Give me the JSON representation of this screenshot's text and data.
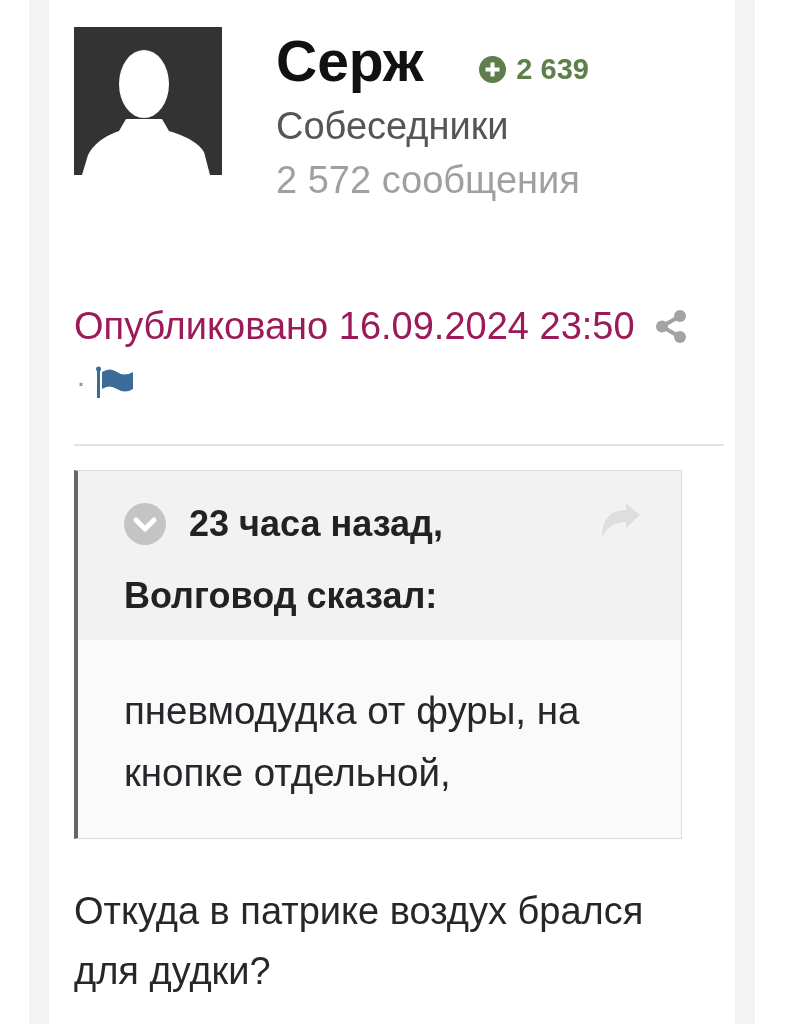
{
  "author": {
    "name": "Серж",
    "reputation": "2 639",
    "group": "Собеседники",
    "post_count": "2 572 сообщения"
  },
  "post_meta": {
    "published": "Опубликовано 16.09.2024 23:50",
    "separator": "·"
  },
  "quote": {
    "time": "23 часа назад,",
    "attribution": "Волговод сказал:",
    "text": "пневмодудка от фуры, на кнопке отдельной,"
  },
  "body": "Откуда в патрике воздух брался для дудки?"
}
